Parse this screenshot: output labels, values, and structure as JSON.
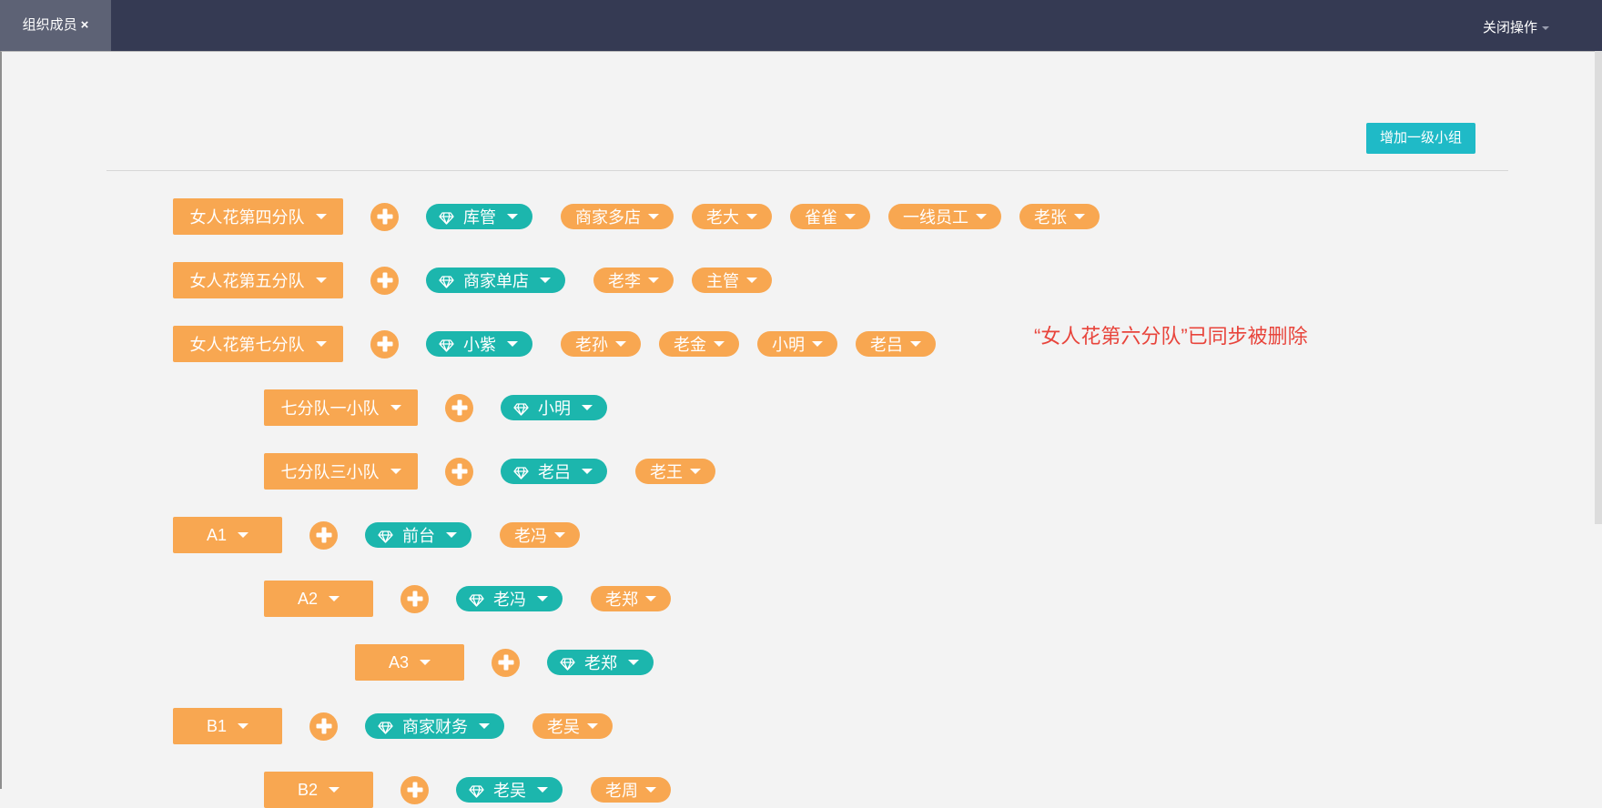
{
  "topbar": {
    "tab_label": "组织成员",
    "tab_close": "×",
    "close_ops_label": "关闭操作"
  },
  "toolbar": {
    "add_top_group_label": "增加一级小组"
  },
  "notice": "“女人花第六分队”已同步被删除",
  "colors": {
    "topbar": "#353a53",
    "tab_active": "#5d6275",
    "group": "#f8a751",
    "leader": "#1cb6ad",
    "add_button": "#1fbac7",
    "notice": "#e8443b"
  },
  "icons": {
    "leader": "diamond-icon",
    "add": "plus-icon",
    "dropdown": "caret-down-icon"
  },
  "rows": [
    {
      "group": "女人花第四分队",
      "level": 1,
      "leader": "库管",
      "members": [
        "商家多店",
        "老大",
        "雀雀",
        "一线员工",
        "老张"
      ]
    },
    {
      "group": "女人花第五分队",
      "level": 1,
      "leader": "商家单店",
      "members": [
        "老李",
        "主管"
      ]
    },
    {
      "group": "女人花第七分队",
      "level": 1,
      "leader": "小紫",
      "members": [
        "老孙",
        "老金",
        "小明",
        "老吕"
      ]
    },
    {
      "group": "七分队一小队",
      "level": 2,
      "leader": "小明",
      "members": []
    },
    {
      "group": "七分队三小队",
      "level": 2,
      "leader": "老吕",
      "members": [
        "老王"
      ]
    },
    {
      "group": "A1",
      "level": 1,
      "leader": "前台",
      "members": [
        "老冯"
      ]
    },
    {
      "group": "A2",
      "level": 2,
      "leader": "老冯",
      "members": [
        "老郑"
      ]
    },
    {
      "group": "A3",
      "level": 3,
      "leader": "老郑",
      "members": []
    },
    {
      "group": "B1",
      "level": 1,
      "leader": "商家财务",
      "members": [
        "老吴"
      ]
    },
    {
      "group": "B2",
      "level": 2,
      "leader": "老吴",
      "members": [
        "老周"
      ]
    }
  ]
}
